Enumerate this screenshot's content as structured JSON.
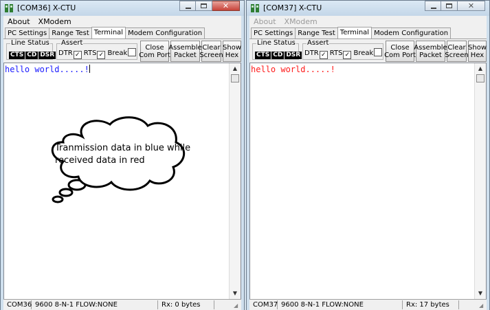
{
  "windows": [
    {
      "title": "[COM36] X-CTU",
      "menu": [
        "About",
        "XModem"
      ],
      "tabs": [
        "PC Settings",
        "Range Test",
        "Terminal",
        "Modem Configuration"
      ],
      "active_tab": "Terminal",
      "line_status": {
        "label": "Line Status",
        "leds": [
          "CTS",
          "CD",
          "DSR"
        ]
      },
      "assert": {
        "label": "Assert",
        "dtr": "DTR",
        "dtr_checked": true,
        "rts": "RTS",
        "rts_checked": true,
        "brk": "Break",
        "break_checked": false
      },
      "buttons": [
        "Close\nCom Port",
        "Assemble\nPacket",
        "Clear\nScreen",
        "Show\nHex"
      ],
      "terminal_text": "hello world.....!",
      "terminal_color": "#1a1aff",
      "status": {
        "port": "COM36",
        "settings": "9600 8-N-1  FLOW:NONE",
        "rx": "Rx: 0 bytes"
      }
    },
    {
      "title": "[COM37] X-CTU",
      "menu": [
        "About",
        "XModem"
      ],
      "tabs": [
        "PC Settings",
        "Range Test",
        "Terminal",
        "Modem Configuration"
      ],
      "active_tab": "Terminal",
      "line_status": {
        "label": "Line Status",
        "leds": [
          "CTS",
          "CD",
          "DSR"
        ]
      },
      "assert": {
        "label": "Assert",
        "dtr": "DTR",
        "dtr_checked": true,
        "rts": "RTS",
        "rts_checked": true,
        "brk": "Break",
        "break_checked": false
      },
      "buttons": [
        "Close\nCom Port",
        "Assemble\nPacket",
        "Clear\nScreen",
        "Show\nHex"
      ],
      "terminal_text": "hello world.....!",
      "terminal_color": "#ff1a1a",
      "status": {
        "port": "COM37",
        "settings": "9600 8-N-1  FLOW:NONE",
        "rx": "Rx: 17 bytes"
      }
    }
  ],
  "annotation": {
    "icon": "thought-bubble-icon",
    "text": "Tranmission data in blue while received data in red"
  }
}
